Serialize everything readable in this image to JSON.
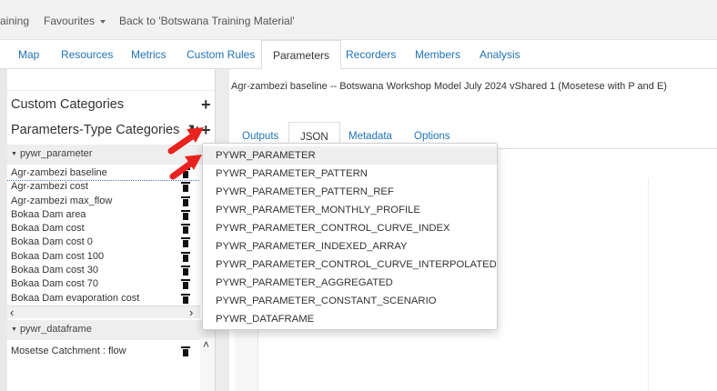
{
  "topnav": {
    "items": [
      "aining",
      "Favourites",
      "Back to 'Botswana Training Material'"
    ]
  },
  "tabs": [
    "Map",
    "Resources",
    "Metrics",
    "Custom Rules",
    "Parameters",
    "Recorders",
    "Members",
    "Analysis"
  ],
  "active_tab": "Parameters",
  "sidebar": {
    "custom_categories": "Custom Categories",
    "parameters_type_categories": "Parameters-Type Categories",
    "groups": [
      {
        "label": "pywr_parameter",
        "items": [
          "Agr-zambezi baseline",
          "Agr-zambezi cost",
          "Agr-zambezi max_flow",
          "Bokaa Dam area",
          "Bokaa Dam cost",
          "Bokaa Dam cost 0",
          "Bokaa Dam cost 100",
          "Bokaa Dam cost 30",
          "Bokaa Dam cost 70",
          "Bokaa Dam evaporation cost"
        ]
      },
      {
        "label": "pywr_dataframe",
        "items": [
          "Mosetse Catchment : flow"
        ]
      }
    ]
  },
  "model_title": "Agr-zambezi baseline -- Botswana Workshop Model July 2024 vShared 1 (Mosetese with P and E)",
  "right_tabs": [
    "Outputs",
    "JSON",
    "Metadata",
    "Options"
  ],
  "active_right_tab": "JSON",
  "dropdown": {
    "options": [
      "PYWR_PARAMETER",
      "PYWR_PARAMETER_PATTERN",
      "PYWR_PARAMETER_PATTERN_REF",
      "PYWR_PARAMETER_MONTHLY_PROFILE",
      "PYWR_PARAMETER_CONTROL_CURVE_INDEX",
      "PYWR_PARAMETER_INDEXED_ARRAY",
      "PYWR_PARAMETER_CONTROL_CURVE_INTERPOLATED",
      "PYWR_PARAMETER_AGGREGATED",
      "PYWR_PARAMETER_CONSTANT_SCENARIO",
      "PYWR_DATAFRAME"
    ],
    "highlighted": "PYWR_PARAMETER"
  },
  "colors": {
    "link": "#1f73b7",
    "annotation_arrow": "#e8231f",
    "topbar_bg": "#f2f2f2"
  }
}
